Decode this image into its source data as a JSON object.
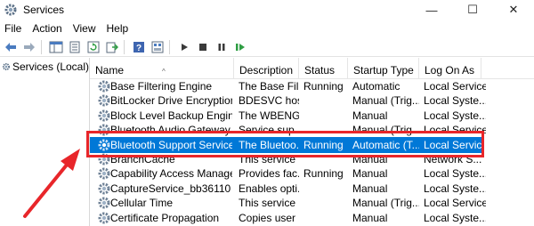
{
  "window": {
    "title": "Services",
    "controls": {
      "minimize": "—",
      "maximize": "☐",
      "close": "✕"
    }
  },
  "menu": [
    "File",
    "Action",
    "View",
    "Help"
  ],
  "left_pane": {
    "root_label": "Services (Local)"
  },
  "columns": [
    "Name",
    "Description",
    "Status",
    "Startup Type",
    "Log On As"
  ],
  "rows": [
    {
      "name": "Base Filtering Engine",
      "description": "The Base Fil...",
      "status": "Running",
      "startup": "Automatic",
      "logon": "Local Service"
    },
    {
      "name": "BitLocker Drive Encryption ...",
      "description": "BDESVC hos...",
      "status": "",
      "startup": "Manual (Trig...",
      "logon": "Local Syste..."
    },
    {
      "name": "Block Level Backup Engine ...",
      "description": "The WBENG...",
      "status": "",
      "startup": "Manual",
      "logon": "Local Syste..."
    },
    {
      "name": "Bluetooth Audio Gateway Se...",
      "description": "Service sup...",
      "status": "",
      "startup": "Manual (Trig...",
      "logon": "Local Service"
    },
    {
      "name": "Bluetooth Support Service",
      "description": "The Bluetoo...",
      "status": "Running",
      "startup": "Automatic (T...",
      "logon": "Local Service",
      "selected": true
    },
    {
      "name": "BranchCache",
      "description": "This service ...",
      "status": "",
      "startup": "Manual",
      "logon": "Network S..."
    },
    {
      "name": "Capability Access Manager ...",
      "description": "Provides fac...",
      "status": "Running",
      "startup": "Manual",
      "logon": "Local Syste..."
    },
    {
      "name": "CaptureService_bb36110",
      "description": "Enables opti...",
      "status": "",
      "startup": "Manual",
      "logon": "Local Syste..."
    },
    {
      "name": "Cellular Time",
      "description": "This service ...",
      "status": "",
      "startup": "Manual (Trig...",
      "logon": "Local Service"
    },
    {
      "name": "Certificate Propagation",
      "description": "Copies user ...",
      "status": "",
      "startup": "Manual",
      "logon": "Local Syste..."
    }
  ],
  "colors": {
    "selection": "#0078d7",
    "annotation": "#e8262a"
  }
}
